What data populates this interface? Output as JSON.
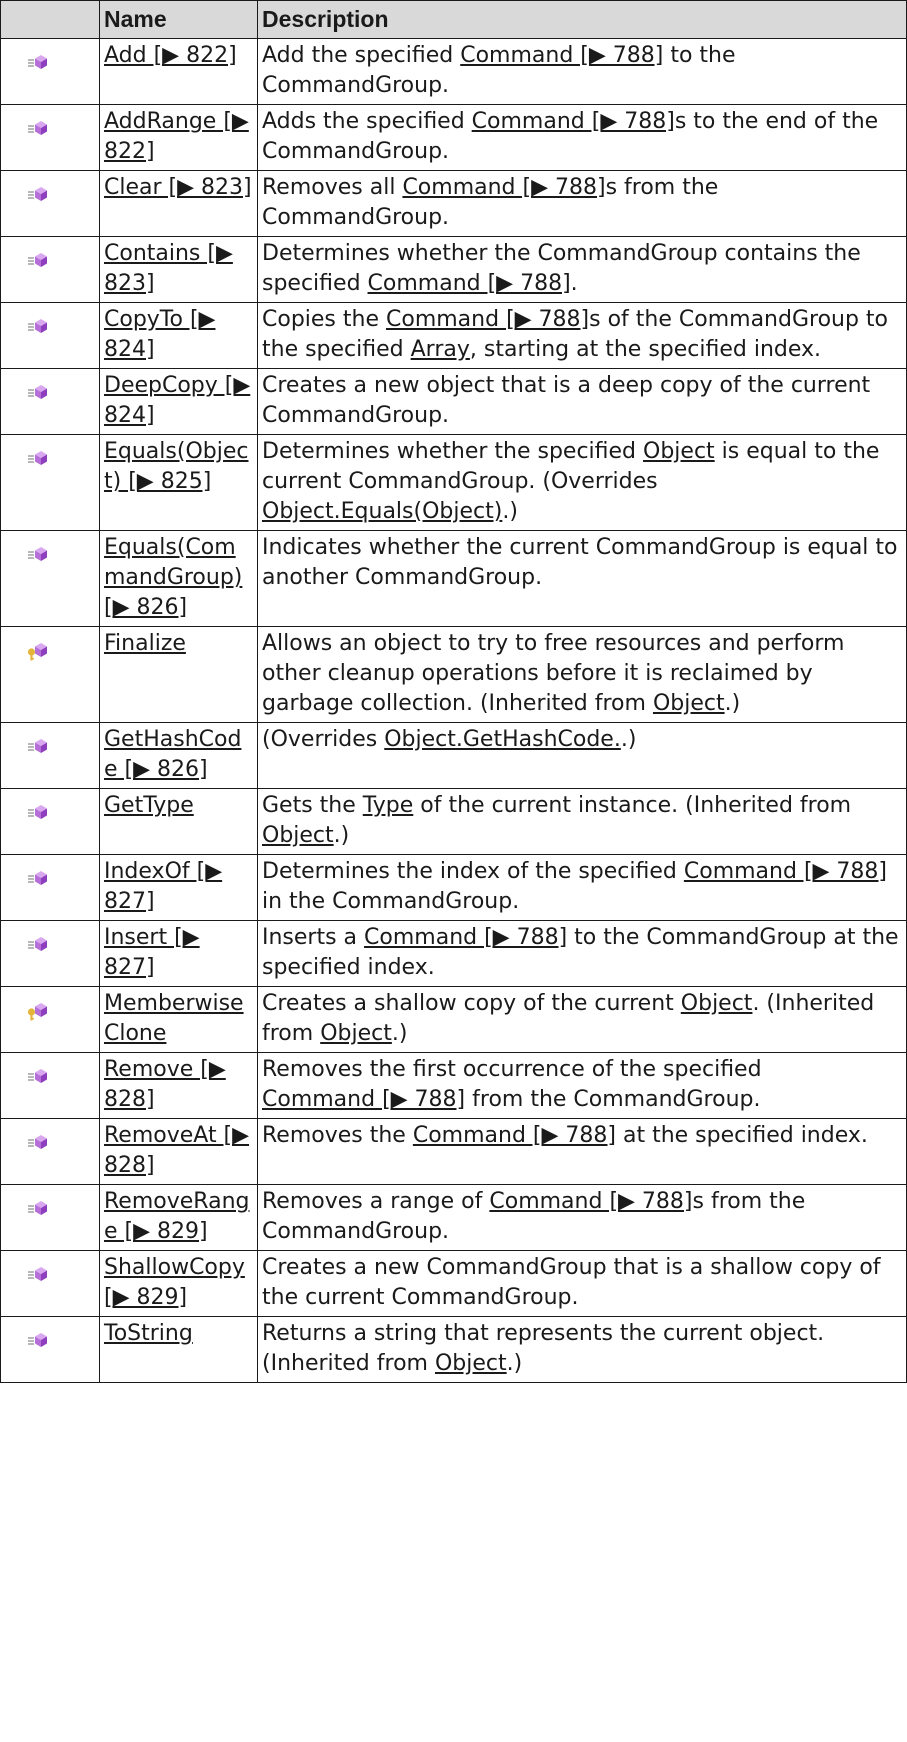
{
  "headers": {
    "icon": "",
    "name": "Name",
    "description": "Description"
  },
  "colors": {
    "header_bg": "#d9d9d9",
    "border": "#1a1a1a",
    "icon_purple": "#b66fd9",
    "icon_yellow": "#e4b53b"
  },
  "rows": [
    {
      "icon": "public-method-icon",
      "name": "Add [▶ 822]",
      "description": [
        "Add the specified ",
        {
          "link": "Command [▶ 788]"
        },
        " to the CommandGroup."
      ]
    },
    {
      "icon": "public-method-icon",
      "name": "AddRange [▶ 822]",
      "description": [
        "Adds the specified ",
        {
          "link": "Command [▶ 788]"
        },
        "s to the end of the CommandGroup."
      ]
    },
    {
      "icon": "public-method-icon",
      "name": "Clear [▶ 823]",
      "description": [
        "Removes all ",
        {
          "link": "Command [▶ 788]"
        },
        "s from the CommandGroup."
      ]
    },
    {
      "icon": "public-method-icon",
      "name": "Contains [▶ 823]",
      "description": [
        "Determines whether the CommandGroup contains the specified ",
        {
          "link": "Command [▶ 788]"
        },
        "."
      ]
    },
    {
      "icon": "public-method-icon",
      "name": "CopyTo [▶ 824]",
      "description": [
        "Copies the ",
        {
          "link": "Command [▶ 788]"
        },
        "s of the CommandGroup to the specified ",
        {
          "link": "Array"
        },
        ", starting at the specified index."
      ]
    },
    {
      "icon": "public-method-icon",
      "name": "DeepCopy [▶ 824]",
      "description": [
        "Creates a new object that is a deep copy of the current CommandGroup."
      ]
    },
    {
      "icon": "public-method-icon",
      "name": "Equals(Object) [▶ 825]",
      "description": [
        "Determines whether the specified ",
        {
          "link": "Object"
        },
        " is equal to the current CommandGroup. (Overrides ",
        {
          "link": "Object.Equals(Object)"
        },
        ".)"
      ]
    },
    {
      "icon": "public-method-icon",
      "name": "Equals(CommandGroup) [▶ 826]",
      "description": [
        "Indicates whether the current CommandGroup is equal to another CommandGroup."
      ]
    },
    {
      "icon": "protected-method-icon",
      "name": "Finalize",
      "description": [
        "Allows an object to try to free resources and perform other cleanup operations before it is reclaimed by garbage collection. (Inherited from ",
        {
          "link": "Object"
        },
        ".)"
      ]
    },
    {
      "icon": "public-method-icon",
      "name": "GetHashCode [▶ 826]",
      "description": [
        "(Overrides ",
        {
          "link": "Object.GetHashCode."
        },
        ".)"
      ]
    },
    {
      "icon": "public-method-icon",
      "name": "GetType",
      "description": [
        "Gets the ",
        {
          "link": "Type"
        },
        " of the current instance. (Inherited from ",
        {
          "link": "Object"
        },
        ".)"
      ]
    },
    {
      "icon": "public-method-icon",
      "name": "IndexOf [▶ 827]",
      "description": [
        "Determines the index of the specified ",
        {
          "link": "Command [▶ 788]"
        },
        " in the CommandGroup."
      ]
    },
    {
      "icon": "public-method-icon",
      "name": "Insert [▶ 827]",
      "description": [
        "Inserts a ",
        {
          "link": "Command [▶ 788]"
        },
        " to the CommandGroup at the specified index."
      ]
    },
    {
      "icon": "protected-method-icon",
      "name": "MemberwiseClone",
      "description": [
        "Creates a shallow copy of the current ",
        {
          "link": "Object"
        },
        ". (Inherited from ",
        {
          "link": "Object"
        },
        ".)"
      ]
    },
    {
      "icon": "public-method-icon",
      "name": "Remove [▶ 828]",
      "description": [
        "Removes the first occurrence of the specified ",
        {
          "link": "Command [▶ 788]"
        },
        " from the CommandGroup."
      ]
    },
    {
      "icon": "public-method-icon",
      "name": "RemoveAt [▶ 828]",
      "description": [
        "Removes the ",
        {
          "link": "Command [▶ 788]"
        },
        " at the specified index."
      ]
    },
    {
      "icon": "public-method-icon",
      "name": "RemoveRange [▶ 829]",
      "description": [
        "Removes a range of ",
        {
          "link": "Command [▶ 788]"
        },
        "s from the CommandGroup."
      ]
    },
    {
      "icon": "public-method-icon",
      "name": "ShallowCopy [▶ 829]",
      "description": [
        "Creates a new CommandGroup that is a shallow copy of the current CommandGroup."
      ]
    },
    {
      "icon": "public-method-icon",
      "name": "ToString",
      "description": [
        "Returns a string that represents the current object. (Inherited from ",
        {
          "link": "Object"
        },
        ".)"
      ]
    }
  ]
}
